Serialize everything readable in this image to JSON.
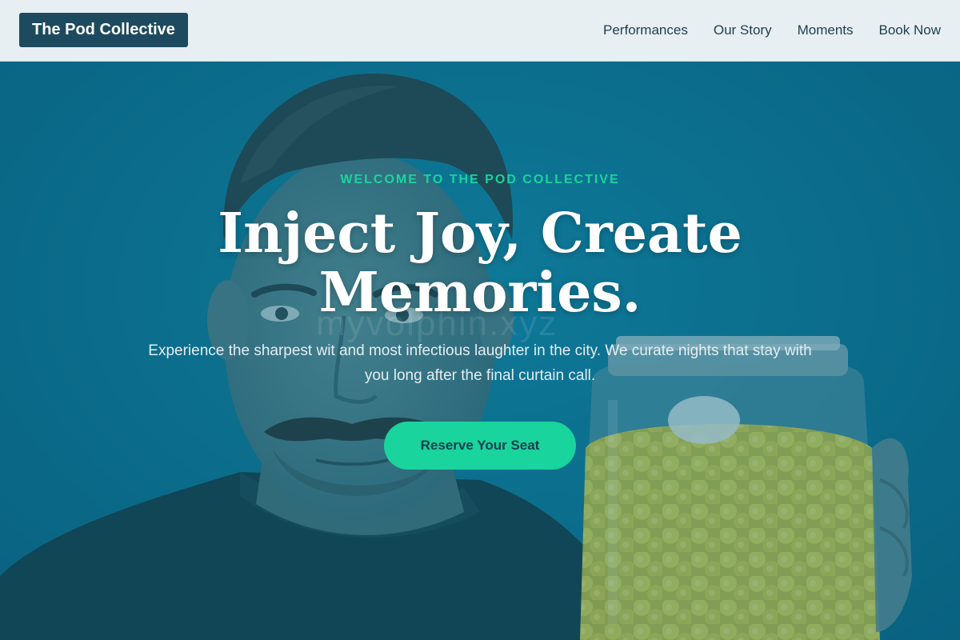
{
  "nav": {
    "brand": "The Pod Collective",
    "links": [
      "Performances",
      "Our Story",
      "Moments",
      "Book Now"
    ]
  },
  "hero": {
    "eyebrow": "WELCOME TO THE POD COLLECTIVE",
    "headline_line1": "Inject Joy, Create",
    "headline_line2": "Memories.",
    "subtext": "Experience the sharpest wit and most infectious laughter in the city. We curate nights that stay with you long after the final curtain call.",
    "cta_label": "Reserve Your Seat",
    "watermark": "myvolphin.xyz"
  },
  "colors": {
    "accent": "#19d49c",
    "brand_bg": "#1d4a5e",
    "hero_bg": "#0c6f8e",
    "nav_bg": "#f0f5f8"
  }
}
